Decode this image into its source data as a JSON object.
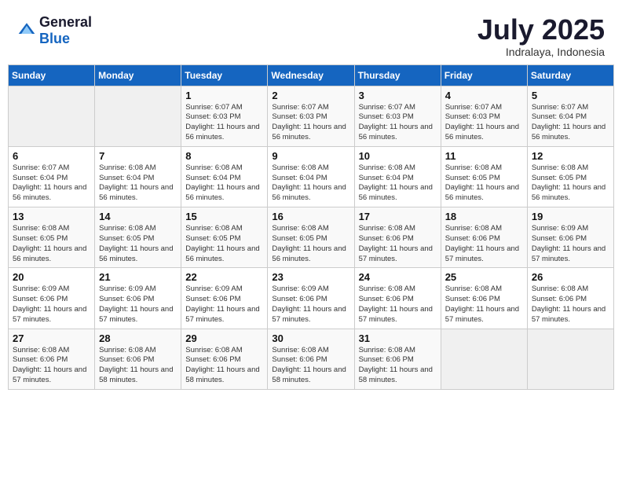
{
  "logo": {
    "text_general": "General",
    "text_blue": "Blue"
  },
  "title": {
    "month_year": "July 2025",
    "location": "Indralaya, Indonesia"
  },
  "days_of_week": [
    "Sunday",
    "Monday",
    "Tuesday",
    "Wednesday",
    "Thursday",
    "Friday",
    "Saturday"
  ],
  "weeks": [
    [
      {
        "day": "",
        "sunrise": "",
        "sunset": "",
        "daylight": ""
      },
      {
        "day": "",
        "sunrise": "",
        "sunset": "",
        "daylight": ""
      },
      {
        "day": "1",
        "sunrise": "Sunrise: 6:07 AM",
        "sunset": "Sunset: 6:03 PM",
        "daylight": "Daylight: 11 hours and 56 minutes."
      },
      {
        "day": "2",
        "sunrise": "Sunrise: 6:07 AM",
        "sunset": "Sunset: 6:03 PM",
        "daylight": "Daylight: 11 hours and 56 minutes."
      },
      {
        "day": "3",
        "sunrise": "Sunrise: 6:07 AM",
        "sunset": "Sunset: 6:03 PM",
        "daylight": "Daylight: 11 hours and 56 minutes."
      },
      {
        "day": "4",
        "sunrise": "Sunrise: 6:07 AM",
        "sunset": "Sunset: 6:03 PM",
        "daylight": "Daylight: 11 hours and 56 minutes."
      },
      {
        "day": "5",
        "sunrise": "Sunrise: 6:07 AM",
        "sunset": "Sunset: 6:04 PM",
        "daylight": "Daylight: 11 hours and 56 minutes."
      }
    ],
    [
      {
        "day": "6",
        "sunrise": "Sunrise: 6:07 AM",
        "sunset": "Sunset: 6:04 PM",
        "daylight": "Daylight: 11 hours and 56 minutes."
      },
      {
        "day": "7",
        "sunrise": "Sunrise: 6:08 AM",
        "sunset": "Sunset: 6:04 PM",
        "daylight": "Daylight: 11 hours and 56 minutes."
      },
      {
        "day": "8",
        "sunrise": "Sunrise: 6:08 AM",
        "sunset": "Sunset: 6:04 PM",
        "daylight": "Daylight: 11 hours and 56 minutes."
      },
      {
        "day": "9",
        "sunrise": "Sunrise: 6:08 AM",
        "sunset": "Sunset: 6:04 PM",
        "daylight": "Daylight: 11 hours and 56 minutes."
      },
      {
        "day": "10",
        "sunrise": "Sunrise: 6:08 AM",
        "sunset": "Sunset: 6:04 PM",
        "daylight": "Daylight: 11 hours and 56 minutes."
      },
      {
        "day": "11",
        "sunrise": "Sunrise: 6:08 AM",
        "sunset": "Sunset: 6:05 PM",
        "daylight": "Daylight: 11 hours and 56 minutes."
      },
      {
        "day": "12",
        "sunrise": "Sunrise: 6:08 AM",
        "sunset": "Sunset: 6:05 PM",
        "daylight": "Daylight: 11 hours and 56 minutes."
      }
    ],
    [
      {
        "day": "13",
        "sunrise": "Sunrise: 6:08 AM",
        "sunset": "Sunset: 6:05 PM",
        "daylight": "Daylight: 11 hours and 56 minutes."
      },
      {
        "day": "14",
        "sunrise": "Sunrise: 6:08 AM",
        "sunset": "Sunset: 6:05 PM",
        "daylight": "Daylight: 11 hours and 56 minutes."
      },
      {
        "day": "15",
        "sunrise": "Sunrise: 6:08 AM",
        "sunset": "Sunset: 6:05 PM",
        "daylight": "Daylight: 11 hours and 56 minutes."
      },
      {
        "day": "16",
        "sunrise": "Sunrise: 6:08 AM",
        "sunset": "Sunset: 6:05 PM",
        "daylight": "Daylight: 11 hours and 56 minutes."
      },
      {
        "day": "17",
        "sunrise": "Sunrise: 6:08 AM",
        "sunset": "Sunset: 6:06 PM",
        "daylight": "Daylight: 11 hours and 57 minutes."
      },
      {
        "day": "18",
        "sunrise": "Sunrise: 6:08 AM",
        "sunset": "Sunset: 6:06 PM",
        "daylight": "Daylight: 11 hours and 57 minutes."
      },
      {
        "day": "19",
        "sunrise": "Sunrise: 6:09 AM",
        "sunset": "Sunset: 6:06 PM",
        "daylight": "Daylight: 11 hours and 57 minutes."
      }
    ],
    [
      {
        "day": "20",
        "sunrise": "Sunrise: 6:09 AM",
        "sunset": "Sunset: 6:06 PM",
        "daylight": "Daylight: 11 hours and 57 minutes."
      },
      {
        "day": "21",
        "sunrise": "Sunrise: 6:09 AM",
        "sunset": "Sunset: 6:06 PM",
        "daylight": "Daylight: 11 hours and 57 minutes."
      },
      {
        "day": "22",
        "sunrise": "Sunrise: 6:09 AM",
        "sunset": "Sunset: 6:06 PM",
        "daylight": "Daylight: 11 hours and 57 minutes."
      },
      {
        "day": "23",
        "sunrise": "Sunrise: 6:09 AM",
        "sunset": "Sunset: 6:06 PM",
        "daylight": "Daylight: 11 hours and 57 minutes."
      },
      {
        "day": "24",
        "sunrise": "Sunrise: 6:08 AM",
        "sunset": "Sunset: 6:06 PM",
        "daylight": "Daylight: 11 hours and 57 minutes."
      },
      {
        "day": "25",
        "sunrise": "Sunrise: 6:08 AM",
        "sunset": "Sunset: 6:06 PM",
        "daylight": "Daylight: 11 hours and 57 minutes."
      },
      {
        "day": "26",
        "sunrise": "Sunrise: 6:08 AM",
        "sunset": "Sunset: 6:06 PM",
        "daylight": "Daylight: 11 hours and 57 minutes."
      }
    ],
    [
      {
        "day": "27",
        "sunrise": "Sunrise: 6:08 AM",
        "sunset": "Sunset: 6:06 PM",
        "daylight": "Daylight: 11 hours and 57 minutes."
      },
      {
        "day": "28",
        "sunrise": "Sunrise: 6:08 AM",
        "sunset": "Sunset: 6:06 PM",
        "daylight": "Daylight: 11 hours and 58 minutes."
      },
      {
        "day": "29",
        "sunrise": "Sunrise: 6:08 AM",
        "sunset": "Sunset: 6:06 PM",
        "daylight": "Daylight: 11 hours and 58 minutes."
      },
      {
        "day": "30",
        "sunrise": "Sunrise: 6:08 AM",
        "sunset": "Sunset: 6:06 PM",
        "daylight": "Daylight: 11 hours and 58 minutes."
      },
      {
        "day": "31",
        "sunrise": "Sunrise: 6:08 AM",
        "sunset": "Sunset: 6:06 PM",
        "daylight": "Daylight: 11 hours and 58 minutes."
      },
      {
        "day": "",
        "sunrise": "",
        "sunset": "",
        "daylight": ""
      },
      {
        "day": "",
        "sunrise": "",
        "sunset": "",
        "daylight": ""
      }
    ]
  ]
}
